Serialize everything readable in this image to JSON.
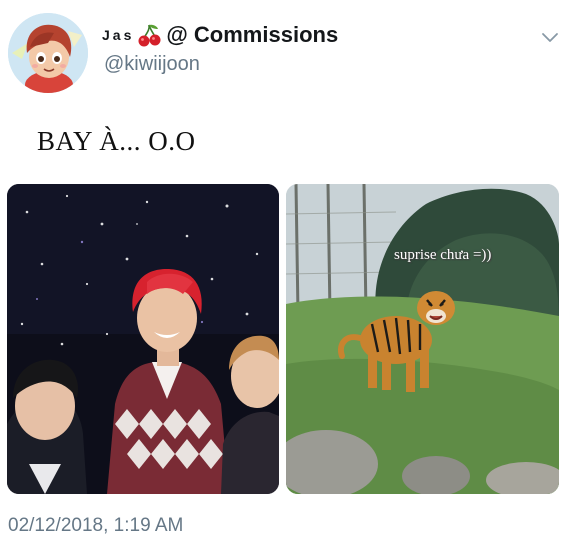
{
  "tweet": {
    "display_name": "Jas",
    "display_name_emoji": "cherry-emoji",
    "display_name_suffix": "@ Commissions",
    "handle": "@kiwiijoon",
    "text": "BAY À... O.O",
    "timestamp": "02/12/2018, 1:19 AM",
    "menu_icon": "chevron-down-icon"
  },
  "media": {
    "left_photo": "concert-audience-photo",
    "right_photo": "tiger-photo",
    "right_caption": "suprise chưa =))"
  },
  "colors": {
    "secondary_text": "#657786",
    "primary_text": "#14171a"
  }
}
